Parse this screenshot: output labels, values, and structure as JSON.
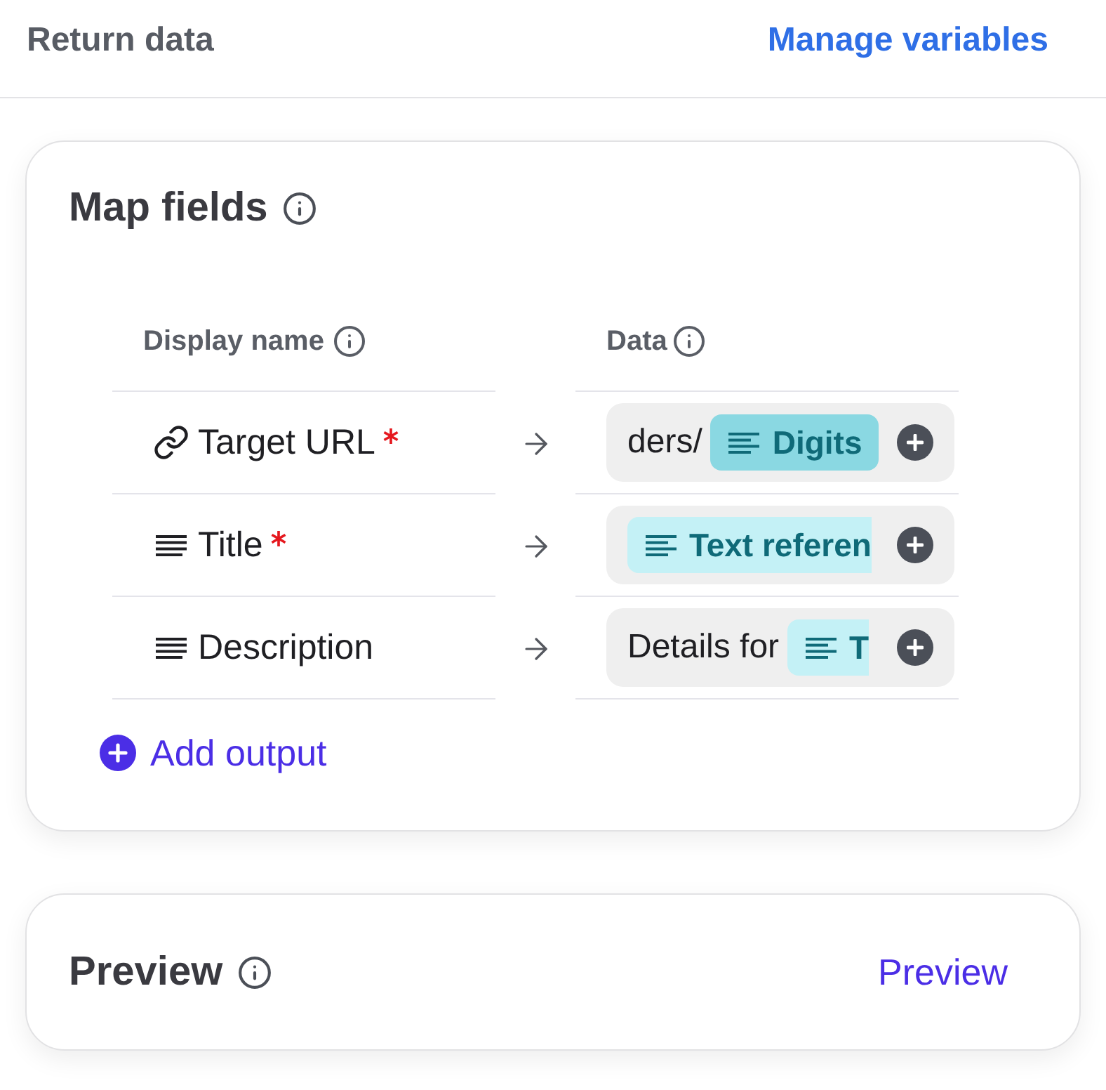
{
  "header": {
    "title": "Return data",
    "action": "Manage variables"
  },
  "map_fields": {
    "title": "Map fields",
    "columns": [
      "Display name",
      "Data"
    ],
    "rows": [
      {
        "kind": "link",
        "name": "Target URL",
        "required": true,
        "value": [
          {
            "kind": "text",
            "text": "ders/"
          },
          {
            "kind": "chip",
            "label": "Digits",
            "selected": true,
            "clipped": false
          }
        ]
      },
      {
        "kind": "text",
        "name": "Title",
        "required": true,
        "value": [
          {
            "kind": "chip",
            "label": "Text referen",
            "selected": false,
            "clipped": true
          }
        ]
      },
      {
        "kind": "text",
        "name": "Description",
        "required": false,
        "value": [
          {
            "kind": "text",
            "text": "Details for"
          },
          {
            "kind": "chip",
            "label": "T",
            "selected": false,
            "clipped": true
          }
        ]
      }
    ],
    "add_button": "Add output"
  },
  "preview": {
    "title": "Preview",
    "action": "Preview"
  }
}
